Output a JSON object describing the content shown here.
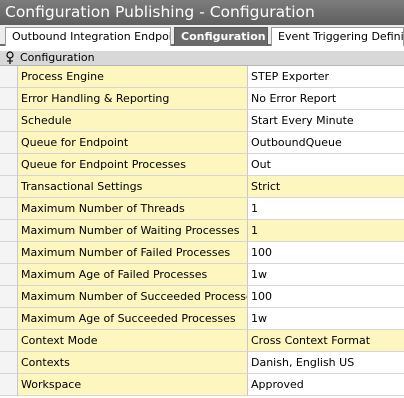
{
  "window": {
    "title": "Configuration Publishing - Configuration"
  },
  "tabs": [
    {
      "label": "Outbound Integration Endpoint",
      "active": false
    },
    {
      "label": "Configuration",
      "active": true
    },
    {
      "label": "Event Triggering Definition",
      "active": false
    }
  ],
  "section": {
    "title": "Configuration",
    "icon": "pin-icon"
  },
  "rows": [
    {
      "key": "Process Engine",
      "value": "STEP Exporter"
    },
    {
      "key": "Error Handling & Reporting",
      "value": "No Error Report"
    },
    {
      "key": "Schedule",
      "value": "Start Every Minute"
    },
    {
      "key": "Queue for Endpoint",
      "value": "OutboundQueue"
    },
    {
      "key": "Queue for Endpoint Processes",
      "value": "Out"
    },
    {
      "key": "Transactional Settings",
      "value": "Strict"
    },
    {
      "key": "Maximum Number of Threads",
      "value": "1"
    },
    {
      "key": "Maximum Number of Waiting Processes",
      "value": "1"
    },
    {
      "key": "Maximum Number of Failed Processes",
      "value": "100"
    },
    {
      "key": "Maximum Age of Failed Processes",
      "value": "1w"
    },
    {
      "key": "Maximum Number of Succeeded Processes",
      "value": "100"
    },
    {
      "key": "Maximum Age of Succeeded Processes",
      "value": "1w"
    },
    {
      "key": "Context Mode",
      "value": "Cross Context Format"
    },
    {
      "key": "Contexts",
      "value": "Danish, English US"
    },
    {
      "key": "Workspace",
      "value": "Approved"
    }
  ],
  "colors": {
    "title_bar": "#6e6e6e",
    "active_tab": "#6a6a6a",
    "key_cell": "#fdf6bf",
    "section_header": "#d8d8d8"
  }
}
